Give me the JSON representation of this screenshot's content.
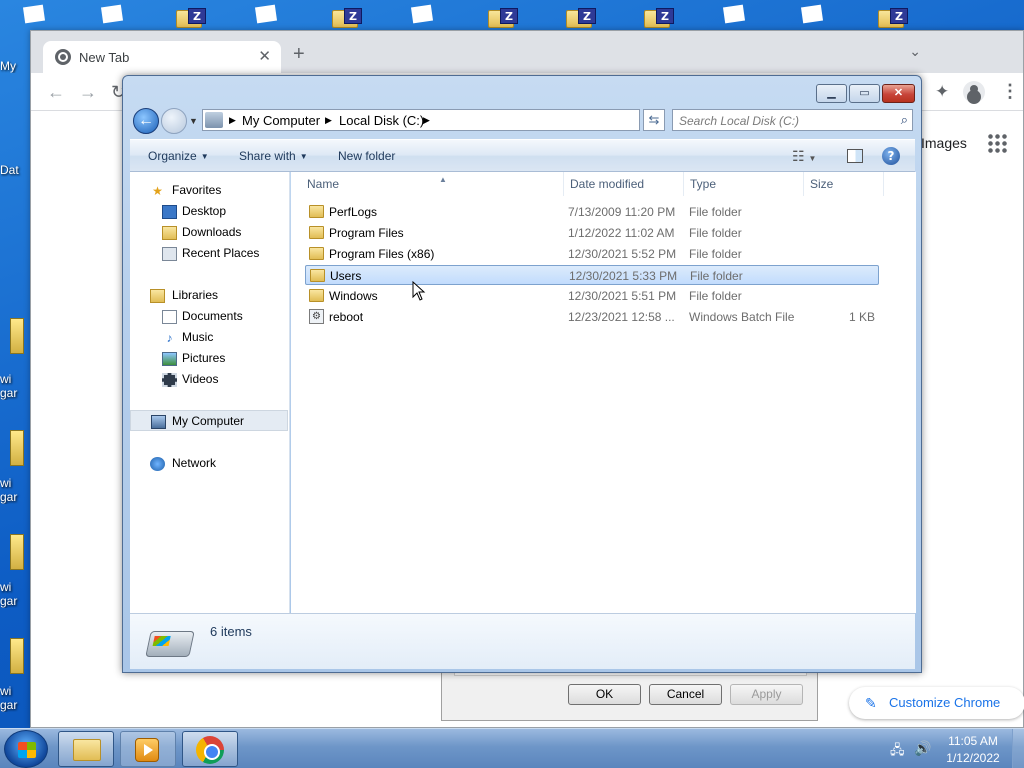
{
  "desktop": {
    "left_labels": [
      "My",
      "Dat",
      "wi",
      "gar",
      "wi",
      "gar",
      "wi",
      "gar",
      "wi",
      "gar"
    ]
  },
  "chrome": {
    "tab_title": "New Tab",
    "images_link": "Images",
    "customize_label": "Customize Chrome"
  },
  "dialog": {
    "breadcrumb": [
      "My Computer",
      "Local Disk (C:)"
    ],
    "search_placeholder": "Search Local Disk (C:)",
    "commands": {
      "organize": "Organize",
      "share_with": "Share with",
      "new_folder": "New folder"
    },
    "nav": {
      "favorites": "Favorites",
      "desktop": "Desktop",
      "downloads": "Downloads",
      "recent_places": "Recent Places",
      "libraries": "Libraries",
      "documents": "Documents",
      "music": "Music",
      "pictures": "Pictures",
      "videos": "Videos",
      "my_computer": "My Computer",
      "network": "Network"
    },
    "columns": {
      "name": "Name",
      "date_modified": "Date modified",
      "type": "Type",
      "size": "Size"
    },
    "files": [
      {
        "name": "PerfLogs",
        "date": "7/13/2009 11:20 PM",
        "type": "File folder",
        "size": ""
      },
      {
        "name": "Program Files",
        "date": "1/12/2022 11:02 AM",
        "type": "File folder",
        "size": ""
      },
      {
        "name": "Program Files (x86)",
        "date": "12/30/2021 5:52 PM",
        "type": "File folder",
        "size": ""
      },
      {
        "name": "Users",
        "date": "12/30/2021 5:33 PM",
        "type": "File folder",
        "size": ""
      },
      {
        "name": "Windows",
        "date": "12/30/2021 5:51 PM",
        "type": "File folder",
        "size": ""
      },
      {
        "name": "reboot",
        "date": "12/23/2021 12:58 ...",
        "type": "Windows Batch File",
        "size": "1 KB"
      }
    ],
    "selected_file": "Users",
    "item_count": "6 items"
  },
  "props_dialog": {
    "ok": "OK",
    "cancel": "Cancel",
    "apply": "Apply"
  },
  "taskbar": {
    "time": "11:05 AM",
    "date": "1/12/2022"
  },
  "colors": {
    "selection": "#c2dcfd",
    "accent": "#1a73e8"
  }
}
